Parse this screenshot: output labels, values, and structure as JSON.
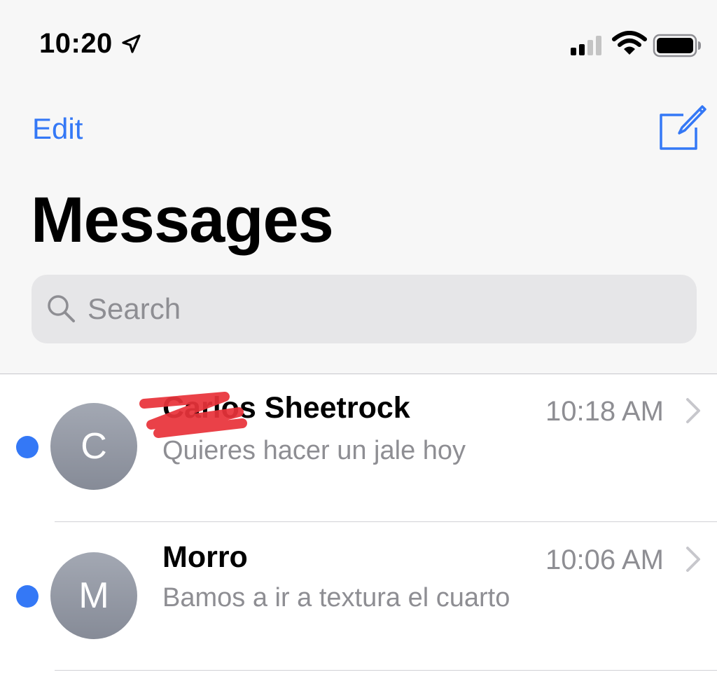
{
  "status_bar": {
    "time": "10:20",
    "icons": [
      "location-arrow-icon",
      "cellular-signal-icon",
      "wifi-icon",
      "battery-icon"
    ]
  },
  "nav": {
    "edit_label": "Edit",
    "compose_icon": "compose-icon",
    "title": "Messages"
  },
  "search": {
    "placeholder": "Search",
    "icon": "search-icon"
  },
  "colors": {
    "accent": "#3478f6",
    "unread_dot": "#3478f6",
    "secondary_text": "#8e8e93",
    "scribble": "#e8333a"
  },
  "conversations": [
    {
      "avatar_initial": "C",
      "name": "Carlos Sheetrock",
      "time": "10:18 AM",
      "preview": "Quieres hacer un jale hoy",
      "unread": true
    },
    {
      "avatar_initial": "M",
      "name": "Morro",
      "time": "10:06 AM",
      "preview": "Bamos a ir a textura el cuarto",
      "unread": true
    }
  ]
}
